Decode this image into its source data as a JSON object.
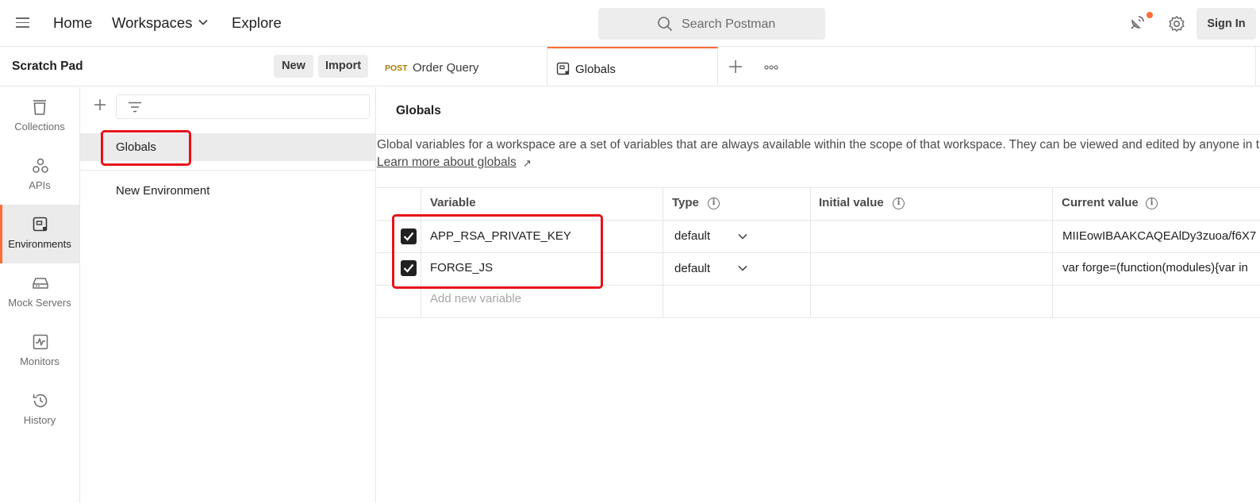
{
  "header": {
    "nav": {
      "home": "Home",
      "workspaces": "Workspaces",
      "explore": "Explore"
    },
    "search_placeholder": "Search Postman",
    "sign_in": "Sign In"
  },
  "workspace": {
    "title": "Scratch Pad",
    "new_label": "New",
    "import_label": "Import"
  },
  "rail": [
    {
      "label": "Collections",
      "icon": "collections-icon"
    },
    {
      "label": "APIs",
      "icon": "apis-icon"
    },
    {
      "label": "Environments",
      "icon": "environments-icon",
      "active": true
    },
    {
      "label": "Mock Servers",
      "icon": "mock-servers-icon"
    },
    {
      "label": "Monitors",
      "icon": "monitors-icon"
    },
    {
      "label": "History",
      "icon": "history-icon"
    }
  ],
  "environments": [
    {
      "label": "Globals",
      "selected": true
    },
    {
      "label": "New Environment",
      "selected": false
    }
  ],
  "tabs": [
    {
      "method": "POST",
      "title": "Order Query"
    },
    {
      "title": "Globals",
      "active": true
    }
  ],
  "globals": {
    "title": "Globals",
    "description": "Global variables for a workspace are a set of variables that are always available within the scope of that workspace. They can be viewed and edited by anyone in that workspace.",
    "learn_more": "Learn more about globals",
    "learn_more_arrow": "↗",
    "columns": {
      "variable": "Variable",
      "type": "Type",
      "initial": "Initial value",
      "current": "Current value"
    },
    "rows": [
      {
        "checked": true,
        "variable": "APP_RSA_PRIVATE_KEY",
        "type": "default",
        "initial": "",
        "current": "MIIEowIBAAKCAQEAlDy3zuoa/f6X7"
      },
      {
        "checked": true,
        "variable": "FORGE_JS",
        "type": "default",
        "initial": "",
        "current": "var forge=(function(modules){var in"
      }
    ],
    "add_placeholder": "Add new variable"
  },
  "colors": {
    "accent": "#ff6c37",
    "highlight": "#e8111a",
    "post_method": "#ad7a03"
  }
}
